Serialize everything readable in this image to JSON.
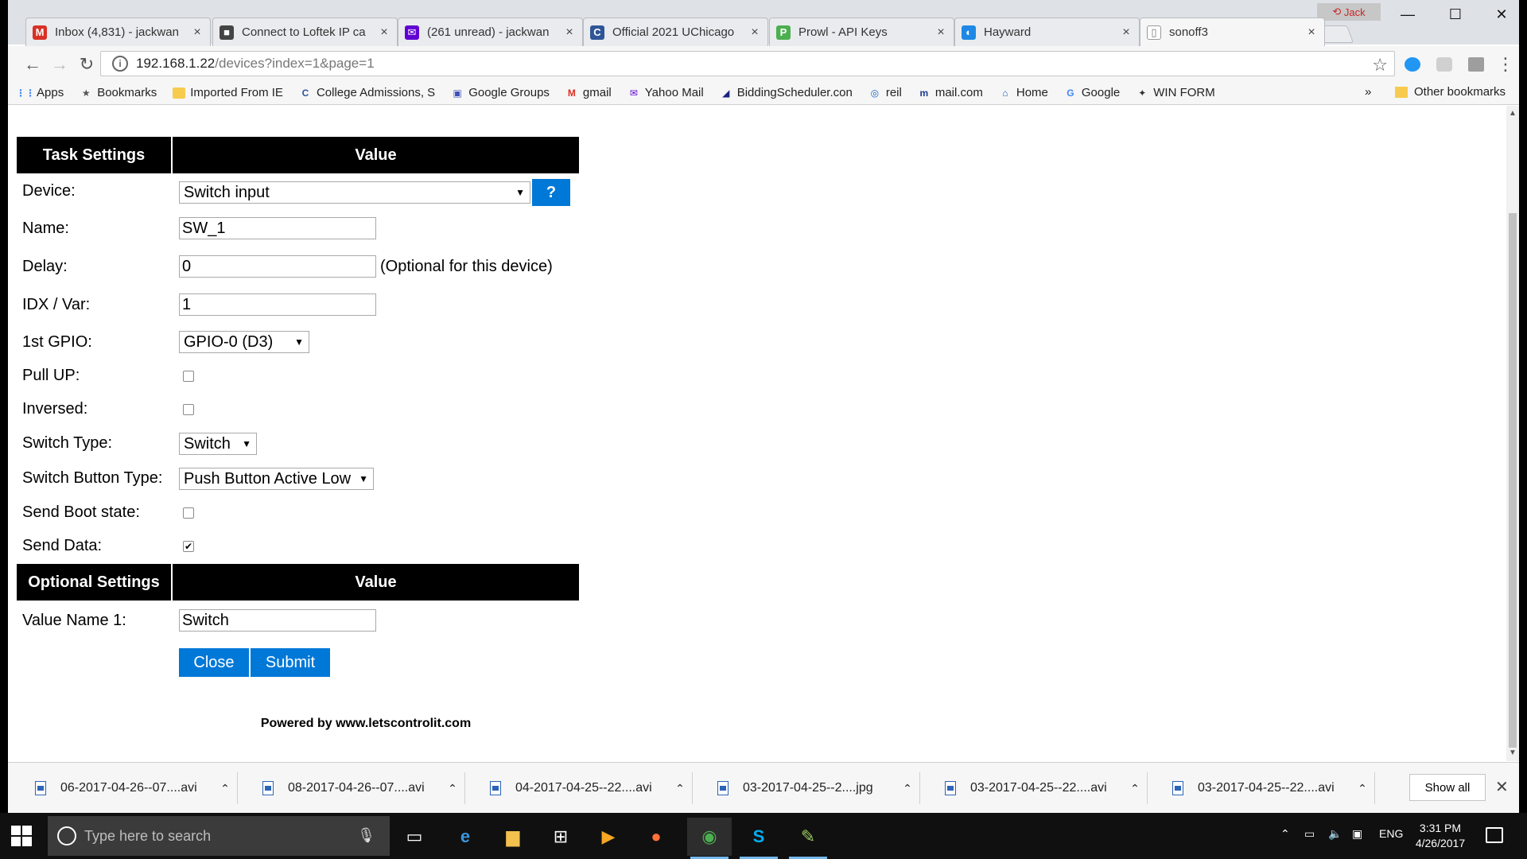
{
  "browser": {
    "tabs": [
      {
        "title": "Inbox (4,831) - jackwan",
        "icon": "gmail-icon",
        "icon_glyph": "M",
        "color": "#d93025"
      },
      {
        "title": "Connect to Loftek IP ca",
        "icon": "camera-icon",
        "icon_glyph": "■",
        "color": "#444444"
      },
      {
        "title": "(261 unread) - jackwan",
        "icon": "yahoo-mail-icon",
        "icon_glyph": "✉",
        "color": "#6001d2"
      },
      {
        "title": "Official 2021 UChicago",
        "icon": "college-confidential-icon",
        "icon_glyph": "C",
        "color": "#2f5597"
      },
      {
        "title": "Prowl - API Keys",
        "icon": "prowl-icon",
        "icon_glyph": "P",
        "color": "#4caf50"
      },
      {
        "title": "Hayward",
        "icon": "hayward-icon",
        "icon_glyph": "◐",
        "color": "#1e88e5"
      },
      {
        "title": "sonoff3",
        "icon": "page-icon",
        "icon_glyph": "▯",
        "color": "#ffffff"
      }
    ],
    "profile_name": "Jack",
    "address": {
      "host": "192.168.1.22",
      "path": "/devices?index=1&page=1"
    },
    "bookmarks": [
      {
        "label": "Apps",
        "icon": "apps-icon",
        "glyph": "⋮⋮",
        "color": "#4285f4"
      },
      {
        "label": "Bookmarks",
        "icon": "star-icon",
        "glyph": "★",
        "color": "#555555"
      },
      {
        "label": "Imported From IE",
        "icon": "folder-icon",
        "glyph": "",
        "color": "#f7cb4d"
      },
      {
        "label": "College Admissions, S",
        "icon": "college-icon",
        "glyph": "C",
        "color": "#2f5597"
      },
      {
        "label": "Google Groups",
        "icon": "google-groups-icon",
        "glyph": "▣",
        "color": "#3f51b5"
      },
      {
        "label": "gmail",
        "icon": "gmail-icon",
        "glyph": "M",
        "color": "#d93025"
      },
      {
        "label": "Yahoo Mail",
        "icon": "yahoo-mail-icon",
        "glyph": "✉",
        "color": "#6001d2"
      },
      {
        "label": "BiddingScheduler.con",
        "icon": "bidding-icon",
        "glyph": "◢",
        "color": "#1a237e"
      },
      {
        "label": "reil",
        "icon": "reil-icon",
        "glyph": "◎",
        "color": "#1565c0"
      },
      {
        "label": "mail.com",
        "icon": "mailcom-icon",
        "glyph": "m",
        "color": "#1a3a8f"
      },
      {
        "label": "Home",
        "icon": "home-icon",
        "glyph": "⌂",
        "color": "#1565c0"
      },
      {
        "label": "Google",
        "icon": "google-icon",
        "glyph": "G",
        "color": "#4285f4"
      },
      {
        "label": "WIN FORM",
        "icon": "winform-icon",
        "glyph": "✦",
        "color": "#333333"
      }
    ],
    "bookmarks_more": "»",
    "other_bookmarks": "Other bookmarks"
  },
  "page": {
    "task_header": "Task Settings",
    "value_header": "Value",
    "optional_header": "Optional Settings",
    "optional_value_header": "Value",
    "device_label": "Device:",
    "device_value": "Switch input",
    "help_label": "?",
    "name_label": "Name:",
    "name_value": "SW_1",
    "delay_label": "Delay:",
    "delay_value": "0",
    "delay_note": "(Optional for this device)",
    "idx_label": "IDX / Var:",
    "idx_value": "1",
    "gpio_label": "1st GPIO:",
    "gpio_value": "GPIO-0 (D3)",
    "pullup_label": "Pull UP:",
    "pullup_checked": false,
    "inversed_label": "Inversed:",
    "inversed_checked": false,
    "switch_type_label": "Switch Type:",
    "switch_type_value": "Switch",
    "switch_button_label": "Switch Button Type:",
    "switch_button_value": "Push Button Active Low",
    "boot_label": "Send Boot state:",
    "boot_checked": false,
    "send_data_label": "Send Data:",
    "send_data_checked": true,
    "value_name_label": "Value Name 1:",
    "value_name_value": "Switch",
    "close_label": "Close",
    "submit_label": "Submit",
    "footer": "Powered by www.letscontrolit.com"
  },
  "downloads": {
    "items": [
      "06-2017-04-26--07....avi",
      "08-2017-04-26--07....avi",
      "04-2017-04-25--22....avi",
      "03-2017-04-25--2....jpg",
      "03-2017-04-25--22....avi",
      "03-2017-04-25--22....avi"
    ],
    "show_all": "Show all"
  },
  "taskbar": {
    "search_placeholder": "Type here to search",
    "language": "ENG",
    "time": "3:31 PM",
    "date": "4/26/2017"
  }
}
